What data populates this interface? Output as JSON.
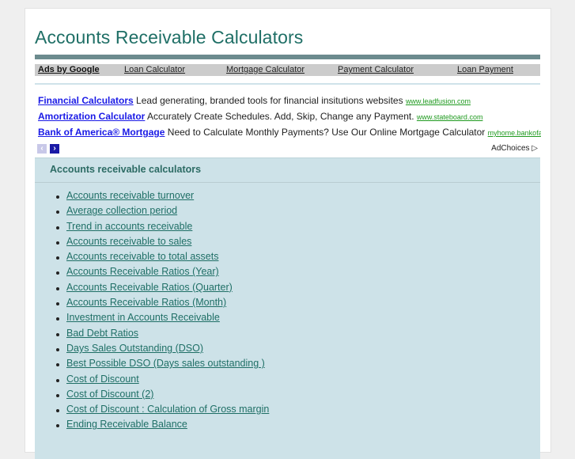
{
  "page": {
    "title": "Accounts Receivable Calculators"
  },
  "nav": {
    "ads_by": "Ads by Google",
    "links": [
      "Loan Calculator",
      "Mortgage Calculator",
      "Payment Calculator",
      "Loan Payment"
    ]
  },
  "ads": [
    {
      "title": "Financial Calculators",
      "text": "Lead generating, branded tools for financial insitutions websites",
      "url": "www.leadfusion.com"
    },
    {
      "title": "Amortization Calculator",
      "text": "Accurately Create Schedules. Add, Skip, Change any Payment.",
      "url": "www.stateboard.com"
    },
    {
      "title": "Bank of America® Mortgage",
      "text": "Need to Calculate Monthly Payments? Use Our Online Mortgage Calculator",
      "url": "myhome.bankofameric"
    }
  ],
  "ad_nav": {
    "prev_icon": "‹",
    "next_icon": "›",
    "adchoices": "AdChoices ▷"
  },
  "section": {
    "heading": "Accounts receivable calculators",
    "items": [
      "Accounts receivable turnover",
      "Average collection period",
      "Trend in accounts receivable",
      "Accounts receivable to sales",
      "Accounts receivable to total assets",
      "Accounts Receivable Ratios (Year)",
      "Accounts Receivable Ratios (Quarter)",
      "Accounts Receivable Ratios (Month)",
      "Investment in Accounts Receivable",
      "Bad Debt Ratios",
      "Days Sales Outstanding (DSO)",
      "Best Possible DSO (Days sales outstanding )",
      "Cost of Discount",
      "Cost of Discount (2)",
      "Cost of Discount : Calculation of Gross margin",
      "Ending Receivable Balance"
    ]
  },
  "colors": {
    "title": "#1f6f66",
    "title_bar": "#6c8b8e",
    "nav_bg": "#cccccc",
    "box_bg": "#cde2e8",
    "ad_link": "#1a1ae6",
    "ad_url": "#1f9a1f"
  }
}
